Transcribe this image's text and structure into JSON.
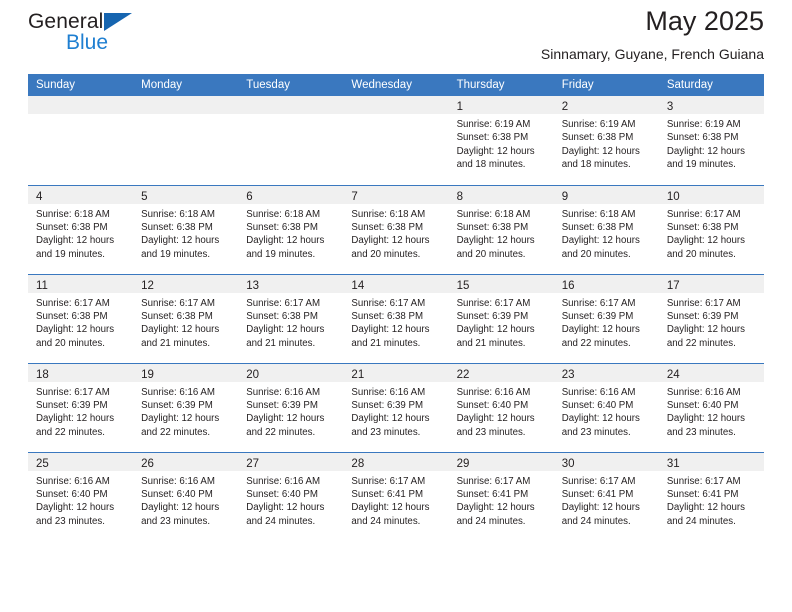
{
  "brand": {
    "name_top": "General",
    "name_bottom": "Blue",
    "triangle_icon": "blue-triangle-logo-mark",
    "color_dark": "#231f20",
    "color_blue": "#1f7fd1"
  },
  "header": {
    "title": "May 2025",
    "subtitle": "Sinnamary, Guyane, French Guiana"
  },
  "theme": {
    "header_bg": "#3a78bf",
    "header_text": "#ffffff",
    "daynum_band_bg": "#f0f0f0",
    "cell_bg": "#ffffff",
    "row_divider": "#3a78bf",
    "body_text": "#231f20"
  },
  "weekdays": [
    "Sunday",
    "Monday",
    "Tuesday",
    "Wednesday",
    "Thursday",
    "Friday",
    "Saturday"
  ],
  "labels": {
    "sunrise_prefix": "Sunrise:",
    "sunset_prefix": "Sunset:",
    "daylight_prefix": "Daylight:"
  },
  "weeks": [
    [
      {
        "day": "",
        "lines": []
      },
      {
        "day": "",
        "lines": []
      },
      {
        "day": "",
        "lines": []
      },
      {
        "day": "",
        "lines": []
      },
      {
        "day": "1",
        "lines": [
          "Sunrise: 6:19 AM",
          "Sunset: 6:38 PM",
          "Daylight: 12 hours",
          "and 18 minutes."
        ]
      },
      {
        "day": "2",
        "lines": [
          "Sunrise: 6:19 AM",
          "Sunset: 6:38 PM",
          "Daylight: 12 hours",
          "and 18 minutes."
        ]
      },
      {
        "day": "3",
        "lines": [
          "Sunrise: 6:19 AM",
          "Sunset: 6:38 PM",
          "Daylight: 12 hours",
          "and 19 minutes."
        ]
      }
    ],
    [
      {
        "day": "4",
        "lines": [
          "Sunrise: 6:18 AM",
          "Sunset: 6:38 PM",
          "Daylight: 12 hours",
          "and 19 minutes."
        ]
      },
      {
        "day": "5",
        "lines": [
          "Sunrise: 6:18 AM",
          "Sunset: 6:38 PM",
          "Daylight: 12 hours",
          "and 19 minutes."
        ]
      },
      {
        "day": "6",
        "lines": [
          "Sunrise: 6:18 AM",
          "Sunset: 6:38 PM",
          "Daylight: 12 hours",
          "and 19 minutes."
        ]
      },
      {
        "day": "7",
        "lines": [
          "Sunrise: 6:18 AM",
          "Sunset: 6:38 PM",
          "Daylight: 12 hours",
          "and 20 minutes."
        ]
      },
      {
        "day": "8",
        "lines": [
          "Sunrise: 6:18 AM",
          "Sunset: 6:38 PM",
          "Daylight: 12 hours",
          "and 20 minutes."
        ]
      },
      {
        "day": "9",
        "lines": [
          "Sunrise: 6:18 AM",
          "Sunset: 6:38 PM",
          "Daylight: 12 hours",
          "and 20 minutes."
        ]
      },
      {
        "day": "10",
        "lines": [
          "Sunrise: 6:17 AM",
          "Sunset: 6:38 PM",
          "Daylight: 12 hours",
          "and 20 minutes."
        ]
      }
    ],
    [
      {
        "day": "11",
        "lines": [
          "Sunrise: 6:17 AM",
          "Sunset: 6:38 PM",
          "Daylight: 12 hours",
          "and 20 minutes."
        ]
      },
      {
        "day": "12",
        "lines": [
          "Sunrise: 6:17 AM",
          "Sunset: 6:38 PM",
          "Daylight: 12 hours",
          "and 21 minutes."
        ]
      },
      {
        "day": "13",
        "lines": [
          "Sunrise: 6:17 AM",
          "Sunset: 6:38 PM",
          "Daylight: 12 hours",
          "and 21 minutes."
        ]
      },
      {
        "day": "14",
        "lines": [
          "Sunrise: 6:17 AM",
          "Sunset: 6:38 PM",
          "Daylight: 12 hours",
          "and 21 minutes."
        ]
      },
      {
        "day": "15",
        "lines": [
          "Sunrise: 6:17 AM",
          "Sunset: 6:39 PM",
          "Daylight: 12 hours",
          "and 21 minutes."
        ]
      },
      {
        "day": "16",
        "lines": [
          "Sunrise: 6:17 AM",
          "Sunset: 6:39 PM",
          "Daylight: 12 hours",
          "and 22 minutes."
        ]
      },
      {
        "day": "17",
        "lines": [
          "Sunrise: 6:17 AM",
          "Sunset: 6:39 PM",
          "Daylight: 12 hours",
          "and 22 minutes."
        ]
      }
    ],
    [
      {
        "day": "18",
        "lines": [
          "Sunrise: 6:17 AM",
          "Sunset: 6:39 PM",
          "Daylight: 12 hours",
          "and 22 minutes."
        ]
      },
      {
        "day": "19",
        "lines": [
          "Sunrise: 6:16 AM",
          "Sunset: 6:39 PM",
          "Daylight: 12 hours",
          "and 22 minutes."
        ]
      },
      {
        "day": "20",
        "lines": [
          "Sunrise: 6:16 AM",
          "Sunset: 6:39 PM",
          "Daylight: 12 hours",
          "and 22 minutes."
        ]
      },
      {
        "day": "21",
        "lines": [
          "Sunrise: 6:16 AM",
          "Sunset: 6:39 PM",
          "Daylight: 12 hours",
          "and 23 minutes."
        ]
      },
      {
        "day": "22",
        "lines": [
          "Sunrise: 6:16 AM",
          "Sunset: 6:40 PM",
          "Daylight: 12 hours",
          "and 23 minutes."
        ]
      },
      {
        "day": "23",
        "lines": [
          "Sunrise: 6:16 AM",
          "Sunset: 6:40 PM",
          "Daylight: 12 hours",
          "and 23 minutes."
        ]
      },
      {
        "day": "24",
        "lines": [
          "Sunrise: 6:16 AM",
          "Sunset: 6:40 PM",
          "Daylight: 12 hours",
          "and 23 minutes."
        ]
      }
    ],
    [
      {
        "day": "25",
        "lines": [
          "Sunrise: 6:16 AM",
          "Sunset: 6:40 PM",
          "Daylight: 12 hours",
          "and 23 minutes."
        ]
      },
      {
        "day": "26",
        "lines": [
          "Sunrise: 6:16 AM",
          "Sunset: 6:40 PM",
          "Daylight: 12 hours",
          "and 23 minutes."
        ]
      },
      {
        "day": "27",
        "lines": [
          "Sunrise: 6:16 AM",
          "Sunset: 6:40 PM",
          "Daylight: 12 hours",
          "and 24 minutes."
        ]
      },
      {
        "day": "28",
        "lines": [
          "Sunrise: 6:17 AM",
          "Sunset: 6:41 PM",
          "Daylight: 12 hours",
          "and 24 minutes."
        ]
      },
      {
        "day": "29",
        "lines": [
          "Sunrise: 6:17 AM",
          "Sunset: 6:41 PM",
          "Daylight: 12 hours",
          "and 24 minutes."
        ]
      },
      {
        "day": "30",
        "lines": [
          "Sunrise: 6:17 AM",
          "Sunset: 6:41 PM",
          "Daylight: 12 hours",
          "and 24 minutes."
        ]
      },
      {
        "day": "31",
        "lines": [
          "Sunrise: 6:17 AM",
          "Sunset: 6:41 PM",
          "Daylight: 12 hours",
          "and 24 minutes."
        ]
      }
    ]
  ]
}
